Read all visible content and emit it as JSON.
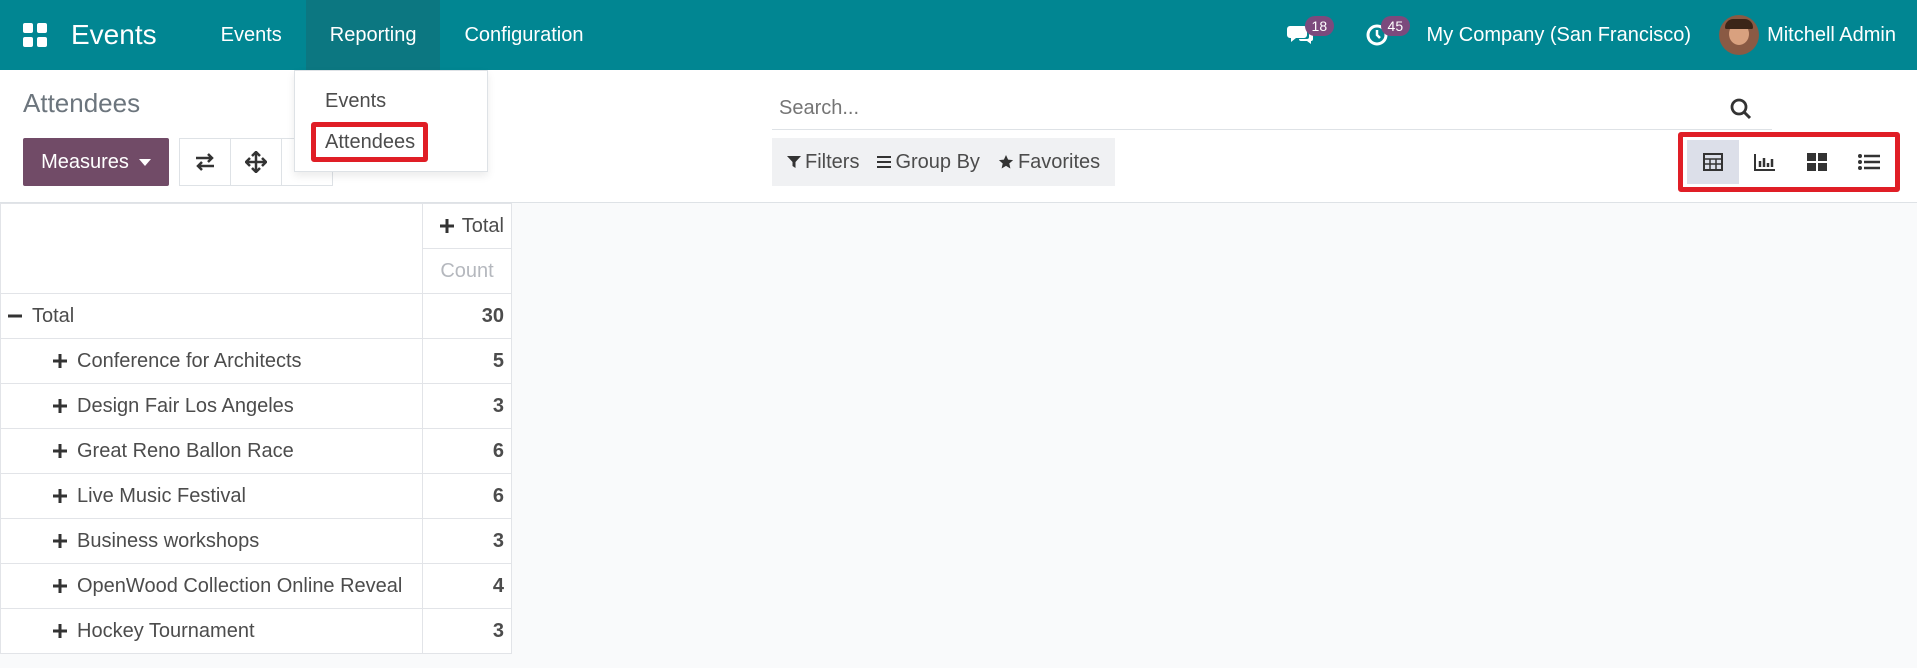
{
  "navbar": {
    "app_name": "Events",
    "menu": [
      "Events",
      "Reporting",
      "Configuration"
    ],
    "messages_count": "18",
    "activities_count": "45",
    "company": "My Company (San Francisco)",
    "user": "Mitchell Admin",
    "accent": "#018692"
  },
  "reporting_dropdown": {
    "items": [
      "Events",
      "Attendees"
    ]
  },
  "control_panel": {
    "breadcrumb": "Attendees",
    "measures_label": "Measures",
    "search_placeholder": "Search...",
    "filters_label": "Filters",
    "group_by_label": "Group By",
    "favorites_label": "Favorites",
    "views": [
      "pivot",
      "graph",
      "kanban",
      "list"
    ],
    "active_view": "pivot"
  },
  "pivot": {
    "col_header": "Total",
    "measure": "Count",
    "total_label": "Total",
    "total_value": "30",
    "rows": [
      {
        "label": "Conference for Architects",
        "value": "5"
      },
      {
        "label": "Design Fair Los Angeles",
        "value": "3"
      },
      {
        "label": "Great Reno Ballon Race",
        "value": "6"
      },
      {
        "label": "Live Music Festival",
        "value": "6"
      },
      {
        "label": "Business workshops",
        "value": "3"
      },
      {
        "label": "OpenWood Collection Online Reveal",
        "value": "4"
      },
      {
        "label": "Hockey Tournament",
        "value": "3"
      }
    ]
  }
}
